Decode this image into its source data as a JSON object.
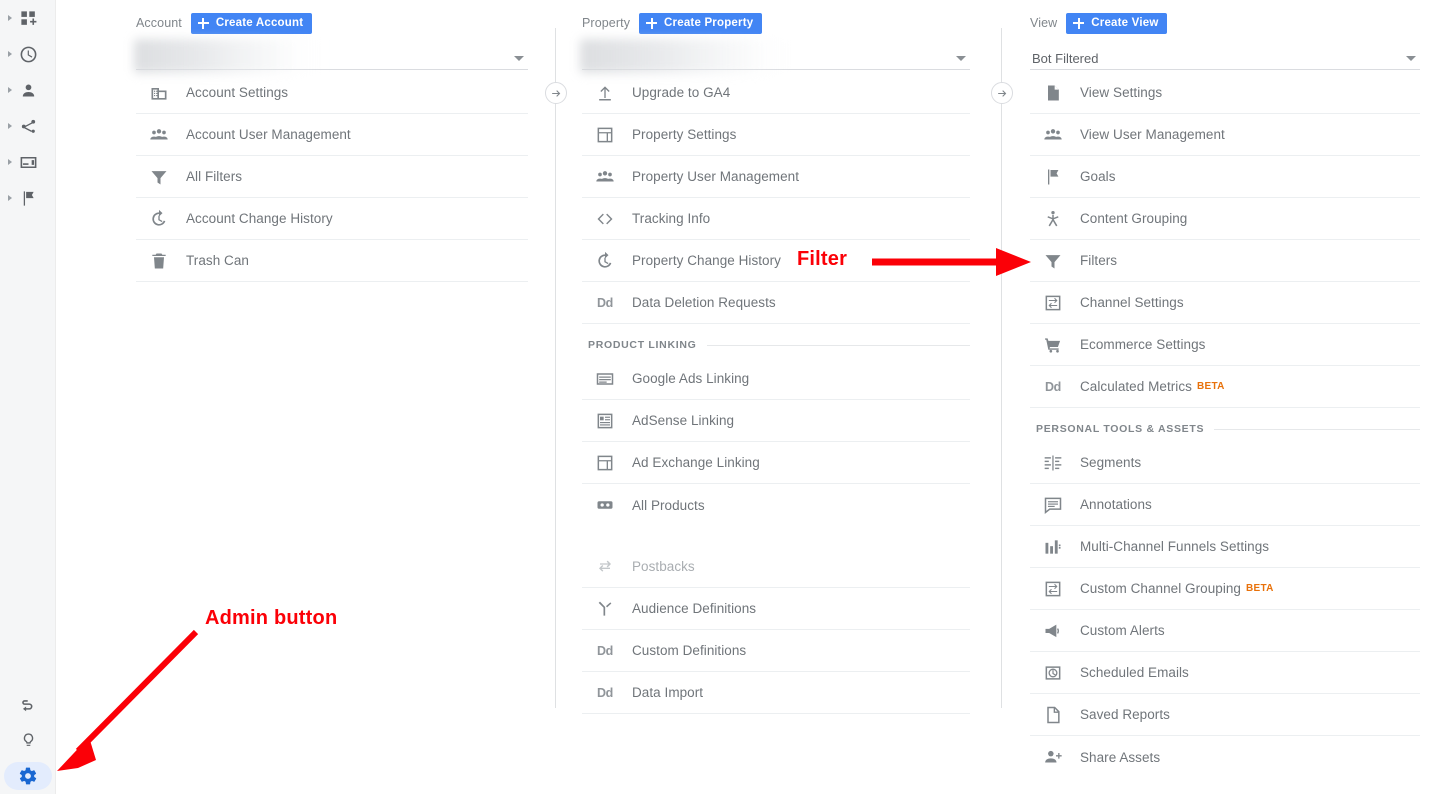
{
  "rail": {
    "items": [
      {
        "name": "customization",
        "icon": "dashboard-plus-icon"
      },
      {
        "name": "realtime",
        "icon": "clock-icon"
      },
      {
        "name": "audience",
        "icon": "person-icon"
      },
      {
        "name": "acquisition",
        "icon": "share-nodes-icon"
      },
      {
        "name": "behavior",
        "icon": "card-icon"
      },
      {
        "name": "conversions",
        "icon": "flag-icon"
      }
    ],
    "bottom": [
      {
        "name": "attribution",
        "icon": "path-icon"
      },
      {
        "name": "discover",
        "icon": "bulb-icon"
      }
    ],
    "admin": {
      "name": "admin",
      "icon": "gear-icon",
      "active": true
    }
  },
  "columns": {
    "account": {
      "label": "Account",
      "create_label": "Create Account",
      "selector_value": "",
      "selector_redacted": true,
      "items": [
        {
          "label": "Account Settings",
          "icon": "building-icon"
        },
        {
          "label": "Account User Management",
          "icon": "people-icon"
        },
        {
          "label": "All Filters",
          "icon": "funnel-icon"
        },
        {
          "label": "Account Change History",
          "icon": "history-icon"
        },
        {
          "label": "Trash Can",
          "icon": "trash-icon"
        }
      ]
    },
    "property": {
      "label": "Property",
      "create_label": "Create Property",
      "selector_value": "",
      "selector_redacted": true,
      "items": [
        {
          "label": "Upgrade to GA4",
          "icon": "upload-icon"
        },
        {
          "label": "Property Settings",
          "icon": "layout-icon"
        },
        {
          "label": "Property User Management",
          "icon": "people-icon"
        },
        {
          "label": "Tracking Info",
          "icon": "code-brackets-icon"
        },
        {
          "label": "Property Change History",
          "icon": "history-icon"
        },
        {
          "label": "Data Deletion Requests",
          "icon": "dd-icon"
        }
      ],
      "section_label": "PRODUCT LINKING",
      "linking_items": [
        {
          "label": "Google Ads Linking",
          "icon": "ads-banner-icon"
        },
        {
          "label": "AdSense Linking",
          "icon": "adsense-icon"
        },
        {
          "label": "Ad Exchange Linking",
          "icon": "layout-icon"
        },
        {
          "label": "All Products",
          "icon": "all-products-icon"
        }
      ],
      "tail_items": [
        {
          "label": "Postbacks",
          "icon": "postbacks-icon",
          "muted": true
        },
        {
          "label": "Audience Definitions",
          "icon": "audience-icon"
        },
        {
          "label": "Custom Definitions",
          "icon": "dd-icon"
        },
        {
          "label": "Data Import",
          "icon": "dd-icon"
        }
      ]
    },
    "view": {
      "label": "View",
      "create_label": "Create View",
      "selector_value": "Bot Filtered",
      "selector_redacted": false,
      "items": [
        {
          "label": "View Settings",
          "icon": "document-icon"
        },
        {
          "label": "View User Management",
          "icon": "people-icon"
        },
        {
          "label": "Goals",
          "icon": "flag-icon"
        },
        {
          "label": "Content Grouping",
          "icon": "content-grouping-icon"
        },
        {
          "label": "Filters",
          "icon": "funnel-icon"
        },
        {
          "label": "Channel Settings",
          "icon": "channel-icon"
        },
        {
          "label": "Ecommerce Settings",
          "icon": "cart-icon"
        },
        {
          "label": "Calculated Metrics",
          "icon": "dd-icon",
          "badge": "BETA"
        }
      ],
      "section_label": "PERSONAL TOOLS & ASSETS",
      "tools_items": [
        {
          "label": "Segments",
          "icon": "segments-icon"
        },
        {
          "label": "Annotations",
          "icon": "comment-icon"
        },
        {
          "label": "Multi-Channel Funnels Settings",
          "icon": "bars-icon"
        },
        {
          "label": "Custom Channel Grouping",
          "icon": "channel-icon",
          "badge": "BETA"
        },
        {
          "label": "Custom Alerts",
          "icon": "megaphone-icon"
        },
        {
          "label": "Scheduled Emails",
          "icon": "alarm-icon"
        },
        {
          "label": "Saved Reports",
          "icon": "page-icon"
        },
        {
          "label": "Share Assets",
          "icon": "person-add-icon"
        }
      ]
    }
  },
  "annotations": {
    "filter_label": "Filter",
    "admin_label": "Admin button",
    "color": "#fb0007"
  },
  "handles": {
    "icon": "arrow-right-circle-icon"
  }
}
